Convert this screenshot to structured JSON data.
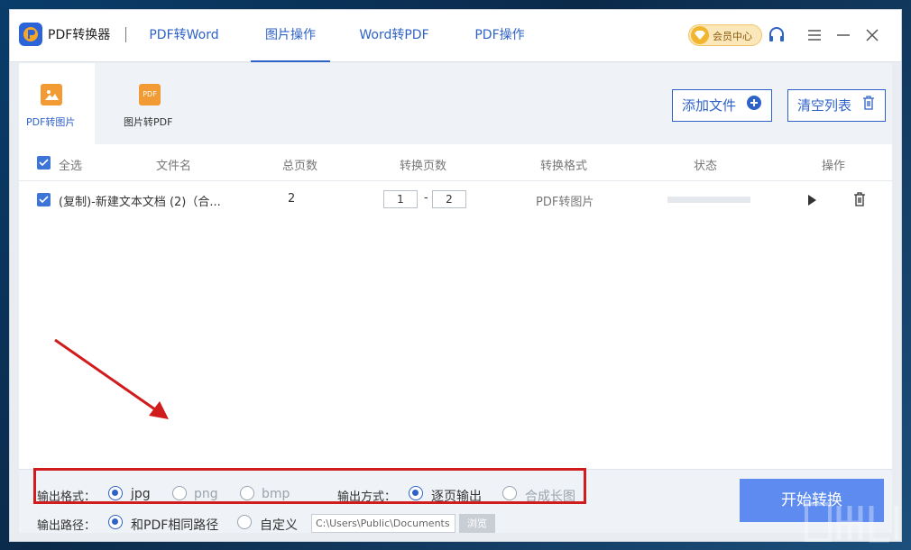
{
  "app": {
    "name": "PDF转换器"
  },
  "tabs": [
    {
      "label": "PDF转Word",
      "active": false
    },
    {
      "label": "图片操作",
      "active": true
    },
    {
      "label": "Word转PDF",
      "active": false
    },
    {
      "label": "PDF操作",
      "active": false
    }
  ],
  "vip": {
    "label": "会员中心"
  },
  "window_controls": [
    "headset-icon",
    "menu-icon",
    "minimize-icon",
    "close-icon"
  ],
  "subnav": [
    {
      "label": "PDF转图片",
      "icon": "image-icon",
      "active": true
    },
    {
      "label": "图片转PDF",
      "icon_text": "PDF",
      "icon": "pdf-icon",
      "active": false
    }
  ],
  "toolbar": {
    "add_label": "添加文件",
    "clear_label": "清空列表"
  },
  "table": {
    "headers": {
      "select_all": "全选",
      "filename": "文件名",
      "total_pages": "总页数",
      "convert_pages": "转换页数",
      "format": "转换格式",
      "status": "状态",
      "actions": "操作"
    },
    "rows": [
      {
        "checked": true,
        "filename": "(复制)-新建文本文档 (2)（合...",
        "total_pages": "2",
        "page_from": "1",
        "page_sep": "-",
        "page_to": "2",
        "format": "PDF转图片",
        "progress": 0
      }
    ]
  },
  "output": {
    "format_label": "输出格式：",
    "formats": [
      {
        "label": "jpg",
        "selected": true
      },
      {
        "label": "png",
        "selected": false
      },
      {
        "label": "bmp",
        "selected": false
      }
    ],
    "mode_label": "输出方式：",
    "modes": [
      {
        "label": "逐页输出",
        "selected": true
      },
      {
        "label": "合成长图",
        "selected": false
      }
    ],
    "path_label": "输出路径：",
    "paths": [
      {
        "label": "和PDF相同路径",
        "selected": true
      },
      {
        "label": "自定义",
        "selected": false
      }
    ],
    "custom_path": "C:\\Users\\Public\\Documents",
    "browse_label": "浏览"
  },
  "start_label": "开始转换",
  "colors": {
    "accent": "#2f62c9",
    "highlight": "#d01c1c",
    "start": "#5e8bf0"
  }
}
